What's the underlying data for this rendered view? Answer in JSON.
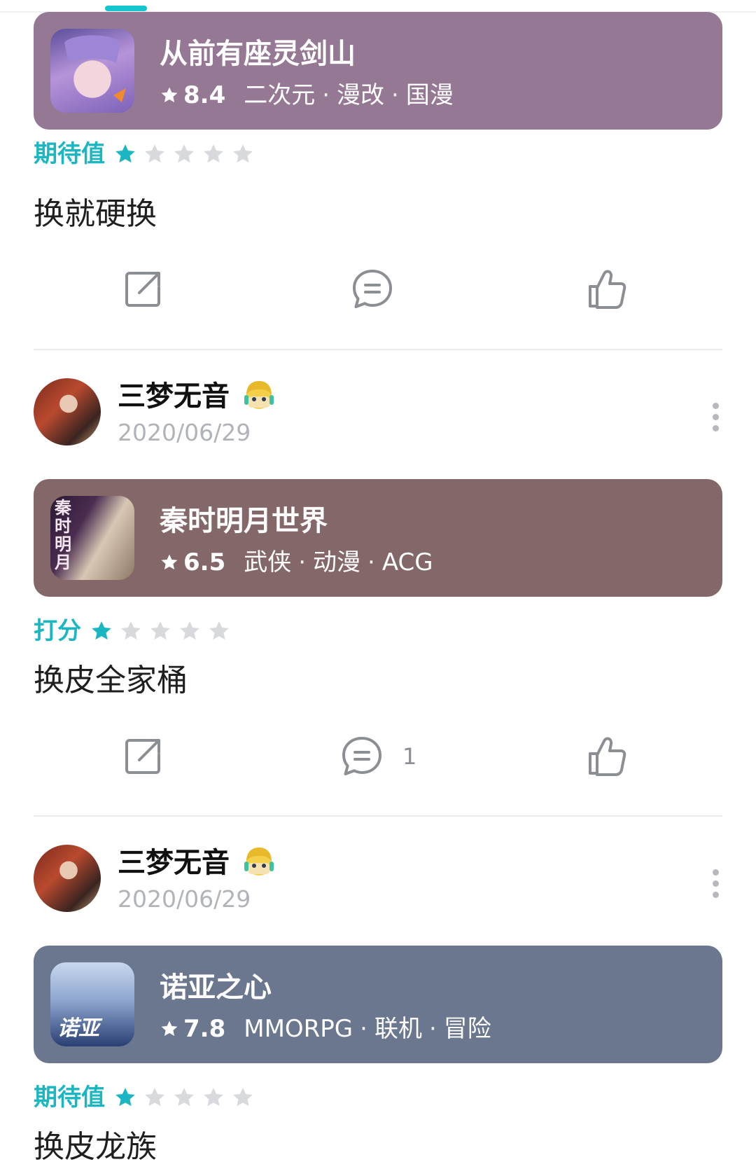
{
  "posts": [
    {
      "game": {
        "title": "从前有座灵剑山",
        "score": "8.4",
        "tags": [
          "二次元",
          "漫改",
          "国漫"
        ],
        "card_color": "#957894"
      },
      "rating": {
        "label": "期待值",
        "stars": 1,
        "max": 5
      },
      "text": "换就硬换",
      "actions": {
        "comment_count": ""
      }
    },
    {
      "user": {
        "name": "三梦无音",
        "date": "2020/06/29"
      },
      "game": {
        "title": "秦时明月世界",
        "score": "6.5",
        "tags": [
          "武侠",
          "动漫",
          "ACG"
        ],
        "card_color": "#846768",
        "icon_text": "秦时明月"
      },
      "rating": {
        "label": "打分",
        "stars": 1,
        "max": 5
      },
      "text": "换皮全家桶",
      "actions": {
        "comment_count": "1"
      }
    },
    {
      "user": {
        "name": "三梦无音",
        "date": "2020/06/29"
      },
      "game": {
        "title": "诺亚之心",
        "score": "7.8",
        "tags": [
          "MMORPG",
          "联机",
          "冒险"
        ],
        "card_color": "#6a778f",
        "icon_text": "诺亚"
      },
      "rating": {
        "label": "期待值",
        "stars": 1,
        "max": 5
      },
      "text": "换皮龙族"
    }
  ],
  "colors": {
    "accent": "#1ab6c2",
    "star_empty": "#d7d9dc",
    "icon": "#8b8e93"
  },
  "icons": {
    "share": "share-icon",
    "comment": "comment-icon",
    "like": "thumbs-up-icon",
    "more": "more-vertical-icon",
    "star": "star-icon"
  }
}
